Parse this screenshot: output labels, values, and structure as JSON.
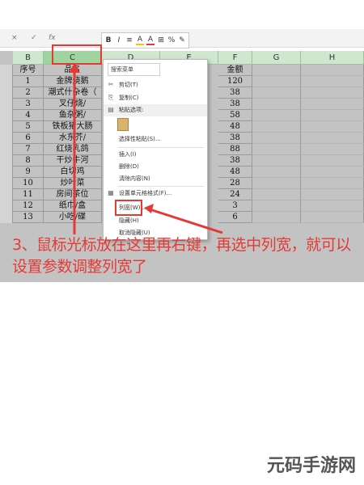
{
  "toolbar": {
    "cancel_icon": "×",
    "confirm_icon": "✓",
    "fx_icon": "fx",
    "mini_toolbar": [
      "B",
      "I",
      "≡",
      "A",
      "A",
      "⊞",
      "%",
      "✎"
    ]
  },
  "columns": [
    "B",
    "C",
    "D",
    "E",
    "F",
    "G",
    "H"
  ],
  "table": {
    "header": {
      "b": "序号",
      "c": "品名",
      "f": "金额"
    },
    "rows": [
      {
        "b": "1",
        "c": "金牌烧鹅",
        "f": "120"
      },
      {
        "b": "2",
        "c": "潮式什杂卷（",
        "f": "38"
      },
      {
        "b": "3",
        "c": "叉仔烧/",
        "f": "38"
      },
      {
        "b": "4",
        "c": "鱼杂粥/",
        "f": "58"
      },
      {
        "b": "5",
        "c": "铁板猪大肠",
        "f": "48"
      },
      {
        "b": "6",
        "c": "水东芥/",
        "f": "38"
      },
      {
        "b": "7",
        "c": "红烧乳鸽",
        "f": "88"
      },
      {
        "b": "8",
        "c": "干炒牛河",
        "f": "38"
      },
      {
        "b": "9",
        "c": "白切鸡",
        "f": "48"
      },
      {
        "b": "10",
        "c": "炒叶菜",
        "f": "28"
      },
      {
        "b": "11",
        "c": "房间茶位",
        "f": "24"
      },
      {
        "b": "12",
        "c": "纸巾/盒",
        "f": "3"
      },
      {
        "b": "13",
        "c": "小吃/碟",
        "f": "6"
      }
    ]
  },
  "context_menu": {
    "search_placeholder": "搜索菜单",
    "items": [
      {
        "icon": "cut-icon",
        "glyph": "✂",
        "label": "剪切(T)"
      },
      {
        "icon": "copy-icon",
        "glyph": "⎘",
        "label": "复制(C)"
      },
      {
        "icon": "paste-icon",
        "glyph": "▤",
        "label": "粘贴选项:"
      },
      {
        "icon": "",
        "glyph": "",
        "label": "选择性粘贴(S)..."
      },
      {
        "icon": "",
        "glyph": "",
        "label": "插入(I)"
      },
      {
        "icon": "",
        "glyph": "",
        "label": "删除(D)"
      },
      {
        "icon": "",
        "glyph": "",
        "label": "清除内容(N)"
      },
      {
        "icon": "format-cells-icon",
        "glyph": "▦",
        "label": "设置单元格格式(F)..."
      },
      {
        "icon": "",
        "glyph": "",
        "label": "列宽(W)..."
      },
      {
        "icon": "",
        "glyph": "",
        "label": "隐藏(H)"
      },
      {
        "icon": "",
        "glyph": "",
        "label": "取消隐藏(U)"
      }
    ]
  },
  "annotation": {
    "text": "3、鼠标光标放在这里再右键，再选中列宽，就可以设置参数调整列宽了",
    "color": "#e53935"
  },
  "watermark": "元码手游网"
}
